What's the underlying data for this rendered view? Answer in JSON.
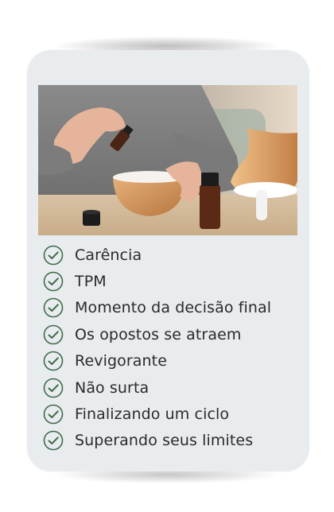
{
  "card": {
    "background": "#e9ecef",
    "icon_color": "#3f6b4a"
  },
  "photo": {
    "icon": "aromatherapy-diffuser-photo"
  },
  "list": {
    "items": [
      {
        "label": "Carência",
        "icon": "check-circle-icon"
      },
      {
        "label": "TPM",
        "icon": "check-circle-icon"
      },
      {
        "label": "Momento da decisão final",
        "icon": "check-circle-icon"
      },
      {
        "label": "Os opostos se atraem",
        "icon": "check-circle-icon"
      },
      {
        "label": "Revigorante",
        "icon": "check-circle-icon"
      },
      {
        "label": "Não surta",
        "icon": "check-circle-icon"
      },
      {
        "label": "Finalizando um ciclo",
        "icon": "check-circle-icon"
      },
      {
        "label": "Superando seus limites",
        "icon": "check-circle-icon"
      }
    ]
  }
}
